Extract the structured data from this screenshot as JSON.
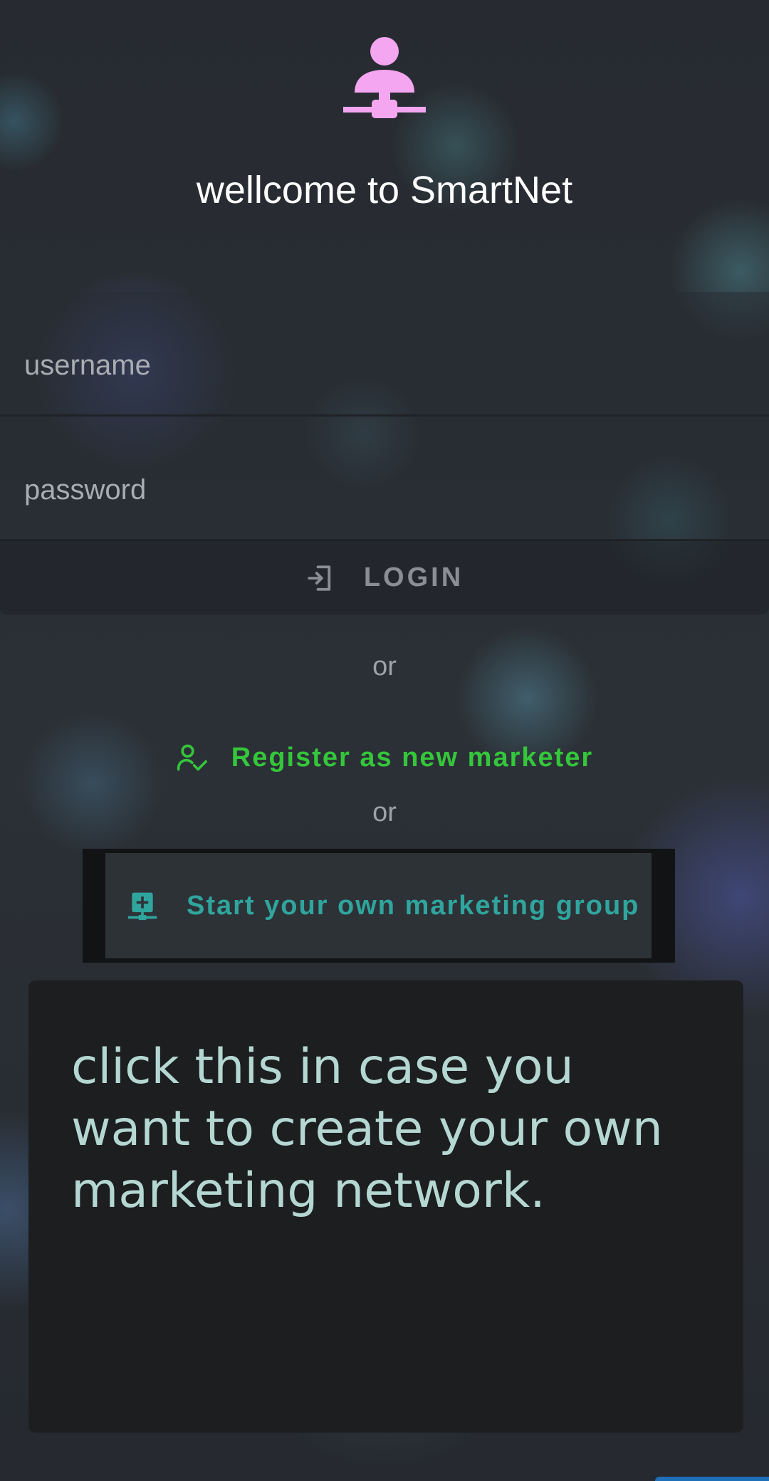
{
  "header": {
    "logo_icon": "network-user-icon",
    "title": "wellcome to SmartNet"
  },
  "login_form": {
    "username_placeholder": "username",
    "password_placeholder": "password",
    "login_icon": "login-arrow-icon",
    "login_label": "LOGIN"
  },
  "separators": {
    "first_or": "or",
    "second_or": "or"
  },
  "register": {
    "icon": "user-check-icon",
    "label": "Register as new marketer"
  },
  "marketing_group": {
    "icon": "network-add-icon",
    "label": "Start your own marketing group"
  },
  "tooltip": {
    "text": "click this in case you want to create your own marketing network."
  },
  "colors": {
    "logo": "#f4a6f0",
    "register": "#35c63b",
    "group": "#2fa59d",
    "tooltip_text": "#b5d7d2"
  }
}
